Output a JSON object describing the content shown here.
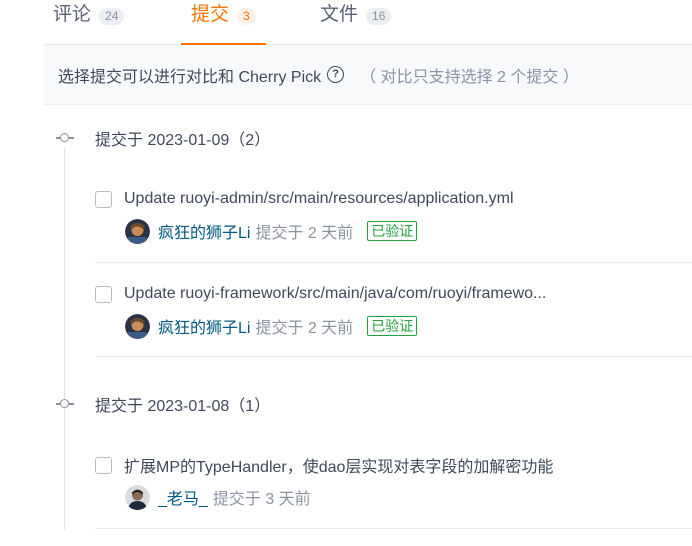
{
  "tabs": [
    {
      "label": "评论",
      "count": "24"
    },
    {
      "label": "提交",
      "count": "3"
    },
    {
      "label": "文件",
      "count": "16"
    }
  ],
  "hint": {
    "text": "选择提交可以进行对比和 Cherry Pick",
    "help_icon": "?",
    "note": "（ 对比只支持选择 2 个提交 ）"
  },
  "groups": [
    {
      "title": "提交于 2023-01-09（2）",
      "commits": [
        {
          "title": "Update ruoyi-admin/src/main/resources/application.yml",
          "author": "疯狂的狮子Li",
          "meta": "提交于 2 天前",
          "badge": "已验证"
        },
        {
          "title": "Update ruoyi-framework/src/main/java/com/ruoyi/framewo...",
          "author": "疯狂的狮子Li",
          "meta": "提交于 2 天前",
          "badge": "已验证"
        }
      ]
    },
    {
      "title": "提交于 2023-01-08（1）",
      "commits": [
        {
          "title": "扩展MP的TypeHandler，使dao层实现对表字段的加解密功能",
          "author": "_老马_",
          "meta": "提交于 3 天前"
        }
      ]
    }
  ],
  "colors": {
    "accent": "#fe7300",
    "verified": "#23a03f",
    "author": "#005980"
  }
}
